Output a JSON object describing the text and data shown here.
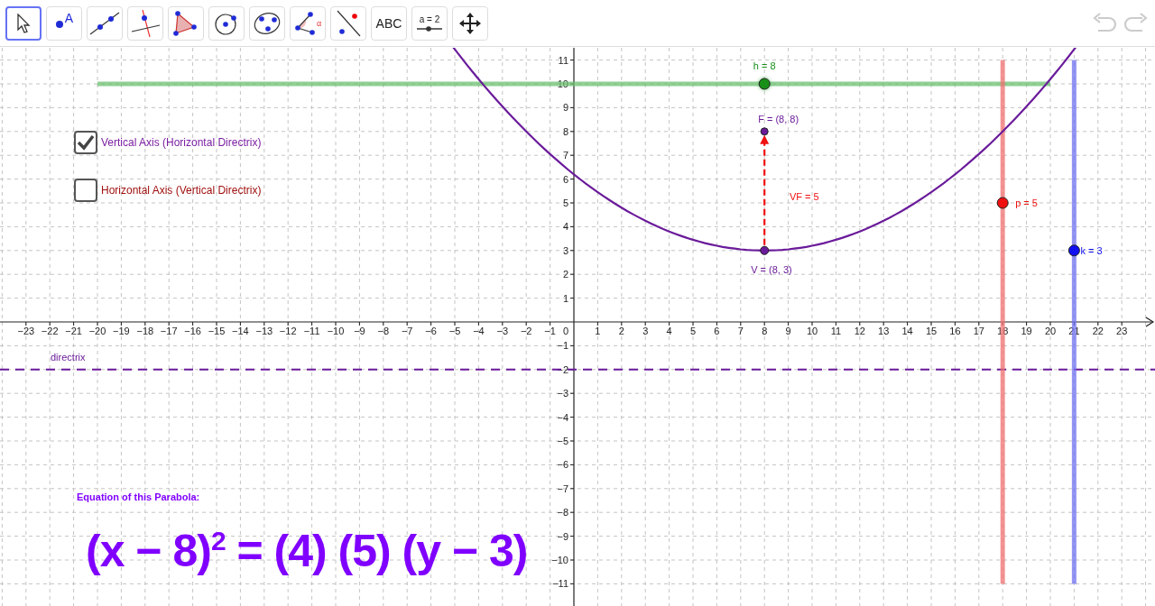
{
  "toolbar": {
    "tools": [
      {
        "kind": "move",
        "selected": true
      },
      {
        "kind": "point",
        "label": "A",
        "selected": false
      },
      {
        "kind": "line",
        "selected": false
      },
      {
        "kind": "perpendicular",
        "selected": false
      },
      {
        "kind": "polygon",
        "selected": false
      },
      {
        "kind": "circle",
        "selected": false
      },
      {
        "kind": "conic",
        "selected": false
      },
      {
        "kind": "angle",
        "label": "α",
        "selected": false
      },
      {
        "kind": "reflect",
        "selected": false
      },
      {
        "kind": "text",
        "label": "ABC",
        "selected": false
      },
      {
        "kind": "slider",
        "label": "a = 2",
        "selected": false
      },
      {
        "kind": "pan",
        "selected": false
      }
    ],
    "undo": {
      "disabled": true
    },
    "redo": {
      "disabled": true
    }
  },
  "checkboxes": [
    {
      "label": "Vertical Axis (Horizontal Directrix)",
      "checked": true,
      "color": "#7b1fa2"
    },
    {
      "label": "Horizontal Axis (Vertical Directrix)",
      "checked": false,
      "color": "#a01010"
    }
  ],
  "graph": {
    "x_tick_labels": [
      "−23",
      "−22",
      "−21",
      "−20",
      "−19",
      "−18",
      "−17",
      "−16",
      "−15",
      "−14",
      "−13",
      "−12",
      "−11",
      "−10",
      "−9",
      "−8",
      "−7",
      "−6",
      "−5",
      "−4",
      "−3",
      "−2",
      "−1",
      "1",
      "2",
      "3",
      "4",
      "5",
      "6",
      "7",
      "8",
      "9",
      "10",
      "11",
      "12",
      "13",
      "14",
      "15",
      "16",
      "17",
      "18",
      "19",
      "20",
      "21",
      "22",
      "23"
    ],
    "y_tick_labels": [
      "11",
      "10",
      "9",
      "8",
      "7",
      "6",
      "5",
      "4",
      "3",
      "2",
      "1",
      "−1",
      "−2",
      "−3",
      "−4",
      "−5",
      "−6",
      "−7",
      "−8",
      "−9",
      "−10",
      "−11"
    ],
    "origin_label": "0",
    "labels": {
      "h": "h = 8",
      "focus": "F = (8, 8)",
      "distance": "VF = 5",
      "p": "p = 5",
      "vertex": "V = (8, 3)",
      "k": "k = 3",
      "directrix": "directrix"
    }
  },
  "equation": {
    "caption": "Equation of this Parabola:",
    "formula": "(x − 8)$^{2}$ = (4) (5) (y − 3)"
  }
}
